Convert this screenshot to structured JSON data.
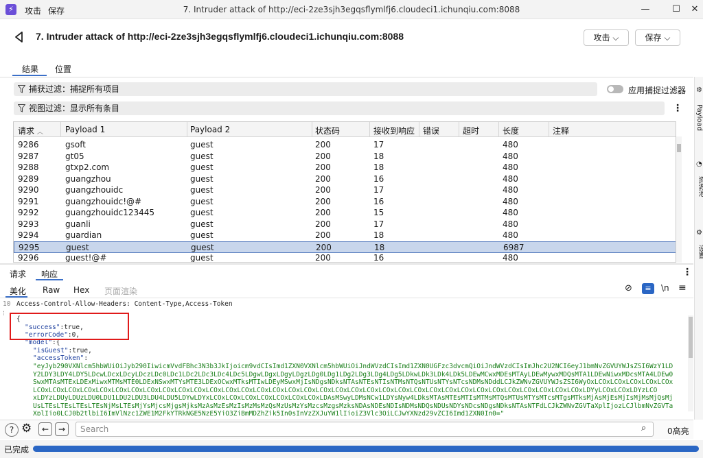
{
  "window": {
    "app_icon": "⚡",
    "menu": [
      "攻击",
      "保存"
    ],
    "title": "7. Intruder attack of http://eci-2ze3sjh3egqsflymlfj6.cloudeci1.ichunqiu.com:8088"
  },
  "header": {
    "title": "7. Intruder attack of http://eci-2ze3sjh3egqsflymlfj6.cloudeci1.ichunqiu.com:8088",
    "attack_btn": "攻击",
    "save_btn": "保存"
  },
  "tabs": [
    "结果",
    "位置"
  ],
  "filters": {
    "capture": "捕获过滤：捕捉所有项目",
    "view": "视图过滤：显示所有条目",
    "apply_toggle_label": "应用捕捉过滤器"
  },
  "table": {
    "columns": [
      "请求",
      "Payload 1",
      "Payload 2",
      "状态码",
      "接收到响应",
      "错误",
      "超时",
      "长度",
      "注释"
    ],
    "rows": [
      [
        "9286",
        "gsoft",
        "guest",
        "200",
        "17",
        "480"
      ],
      [
        "9287",
        "gt05",
        "guest",
        "200",
        "18",
        "480"
      ],
      [
        "9288",
        "gtxp2.com",
        "guest",
        "200",
        "18",
        "480"
      ],
      [
        "9289",
        "guangzhou",
        "guest",
        "200",
        "16",
        "480"
      ],
      [
        "9290",
        "guangzhouidc",
        "guest",
        "200",
        "17",
        "480"
      ],
      [
        "9291",
        "guangzhouidc!@#",
        "guest",
        "200",
        "16",
        "480"
      ],
      [
        "9292",
        "guangzhouidc123445",
        "guest",
        "200",
        "15",
        "480"
      ],
      [
        "9293",
        "guanli",
        "guest",
        "200",
        "17",
        "480"
      ],
      [
        "9294",
        "guardian",
        "guest",
        "200",
        "18",
        "480"
      ],
      [
        "9295",
        "guest",
        "guest",
        "200",
        "18",
        "6987"
      ],
      [
        "9296",
        "guest!@#",
        "guest",
        "200",
        "16",
        "480"
      ]
    ],
    "selected_request": "9295"
  },
  "bottom_tabs": [
    "请求",
    "响应"
  ],
  "view_tabs": [
    "美化",
    "Raw",
    "Hex",
    "页面渲染"
  ],
  "code": {
    "line_number": "10",
    "header_line": "Access-Control-Allow-Headers: Content-Type,Access-Token",
    "open_brace": "{",
    "success_key": "\"success\"",
    "success_val": ":true,",
    "errorcode_key": "\"errorCode\"",
    "errorcode_val": ":0,",
    "model_key": "\"model\"",
    "model_val": ":{",
    "isguest_key": "\"isGuest\"",
    "isguest_val": ":true,",
    "token_key": "\"accessToken\"",
    "token_val": ":",
    "token_lines": [
      "\"eyJyb290VXNlcm5hbWUiOiJyb290IiwicmVvdFBhc3N3b3JkIjoicm9vdCIsImd1ZXN0VXNlcm5hbWUiOiJndWVzdCIsImd1ZXN0UGFzc3dvcmQiOiJndWVzdCIsImJhc2U2NCI6eyJ1bmNvZGVUYWJsZSI6WzY1LD",
      "Y2LDY3LDY4LDY5LDcwLDcxLDcyLDczLDc0LDc1LDc2LDc3LDc4LDc5LDgwLDgxLDgyLDgzLDg0LDg1LDg2LDg3LDg4LDg5LDkwLDk3LDk4LDk5LDEwMCwxMDEsMTAyLDEwMywxMDQsMTA1LDEwNiwxMDcsMTA4LDEw0",
      "SwxMTAsMTExLDExMiwxMTMsMTE0LDExNSwxMTYsMTE3LDExOCwxMTksMTIwLDEyMSwxMjIsNDgsNDksNTAsNTEsNTIsNTMsNTQsNTUsNTYsNTcsNDMsNDddLCJkZWNvZGVUYWJsZSI6WyOxLCOxLCOxLCOxLCOxLCOx",
      "LCOxLCOxLCOxLCOxLCOxLCOxLCOxLCOxLCOxLCOxLCOxLCOxLCOxLCOxLCOxLCOxLCOxLCOxLCOxLCOxLCOxLCOxLCOxLCOxLCOxLCOxLCOxLCOxLCOxLCOxLCOxLCOxLCOxLCOxLCOxLDYyLCOxLCOxLDYzLCO",
      "xLDYzLDUyLDUzLDU0LDU1LDU2LDU3LDU4LDU5LDYwLDYxLCOxLCOxLCOxLCOxLCOxLCOxLCOxLDAsMSwyLDMsNCw1LDYsNyw4LDksMTAsMTEsMTIsMTMsMTQsMTUsMTYsMTcsMTgsMTksMjAsMjEsMjIsMjMsMjQsMj",
      "UsLTEsLTEsLTEsLTEsNjMsLTEsMjYsMjcsMjgsMjksMzAsMzEsMzIsMzMsMzQsMzUsMzYsMzcsMzgsMzksNDAsNDEsNDIsNDMsNDQsNDUsNDYsNDcsNDgsNDksNTAsNTFdLCJkZWNvZGVTaXplIjozLCJlbmNvZGVTa",
      "XplIjo0LCJ0b2tlbiI6ImVlNzc1ZWE1M2FkYTRkNGE5NzE5YjQ3ZjBmMDZhZjk5In0sInVzZXJuYW1lIjoiZ3Vlc3QiLCJwYXNzd29yZCI6Imd1ZXN0In0=\""
    ]
  },
  "bottom": {
    "search_placeholder": "Search",
    "highlight": "0高亮"
  },
  "status": {
    "text": "已完成",
    "progress": 1.0
  },
  "right_strip": [
    "Payload",
    "资源池",
    "设置"
  ]
}
